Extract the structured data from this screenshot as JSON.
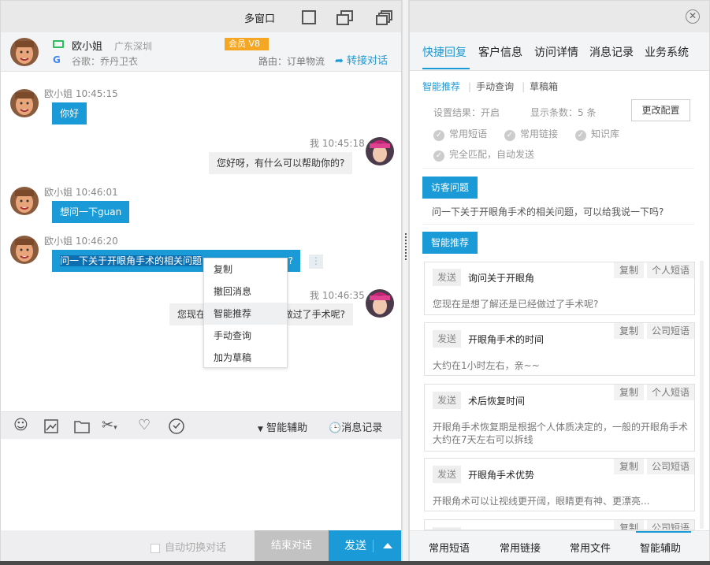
{
  "window": {
    "multi_window": "多窗口"
  },
  "customer": {
    "name": "欧小姐",
    "location": "广东深圳",
    "member_badge": "会员 V8",
    "source": "谷歌：乔丹卫衣",
    "route": "路由：订单物流",
    "transfer": "转接对话"
  },
  "messages": [
    {
      "sender": "欧小姐",
      "time": "10:45:15",
      "meta": "欧小姐 10:45:15",
      "text": "你好",
      "side": "in"
    },
    {
      "sender": "我",
      "time": "10:45:18",
      "meta": "我 10:45:18",
      "text": "您好呀，有什么可以帮助你的?",
      "side": "out"
    },
    {
      "sender": "欧小姐",
      "time": "10:46:01",
      "meta": "欧小姐 10:46:01",
      "text": "想问一下guan",
      "side": "in"
    },
    {
      "sender": "欧小姐",
      "time": "10:46:20",
      "meta": "欧小姐 10:46:20",
      "text": "问一下关于开眼角手术的相关问题",
      "text_tail": "?",
      "side": "in"
    },
    {
      "sender": "我",
      "time": "10:46:35",
      "meta": "我 10:46:35",
      "text_left": "您现在",
      "text_right": "做过了手术呢?",
      "side": "out"
    }
  ],
  "context_menu": [
    "复制",
    "撤回消息",
    "智能推荐",
    "手动查询",
    "加为草稿"
  ],
  "toolbar": {
    "smart_assist": "智能辅助",
    "history": "消息记录"
  },
  "footer": {
    "auto_switch": "自动切换对话",
    "end_chat": "结束对话",
    "send": "发送"
  },
  "right_tabs": [
    "快捷回复",
    "客户信息",
    "访问详情",
    "消息记录",
    "业务系统"
  ],
  "sub_tabs": [
    "智能推荐",
    "手动查询",
    "草稿箱"
  ],
  "config": {
    "result": "设置结果：开启",
    "count": "显示条数：5  条",
    "change_btn": "更改配置"
  },
  "options": [
    "常用短语",
    "常用链接",
    "知识库",
    "完全匹配，自动发送"
  ],
  "visitor_question": {
    "tag": "访客问题",
    "text": "问一下关于开眼角手术的相关问题，可以给我说一下吗?"
  },
  "smart_tag": "智能推荐",
  "cards": [
    {
      "send": "发送",
      "title": "询问关于开眼角",
      "copy": "复制",
      "type": "个人短语",
      "body": "您现在是想了解还是已经做过了手术呢?"
    },
    {
      "send": "发送",
      "title": "开眼角手术的时间",
      "copy": "复制",
      "type": "公司短语",
      "body": "大约在1小时左右，亲~~"
    },
    {
      "send": "发送",
      "title": "术后恢复时间",
      "copy": "复制",
      "type": "个人短语",
      "body": "开眼角手术恢复期是根据个人体质决定的，一般的开眼角手术大约在7天左右可以拆线"
    },
    {
      "send": "发送",
      "title": "开眼角手术优势",
      "copy": "复制",
      "type": "公司短语",
      "body": "开眼角术可以让视线更开阔，眼睛更有神、更漂亮..."
    },
    {
      "send": "发送",
      "title": "",
      "copy": "复制",
      "type": "公司短语",
      "body": ""
    }
  ],
  "right_footer": [
    "常用短语",
    "常用链接",
    "常用文件",
    "智能辅助"
  ]
}
